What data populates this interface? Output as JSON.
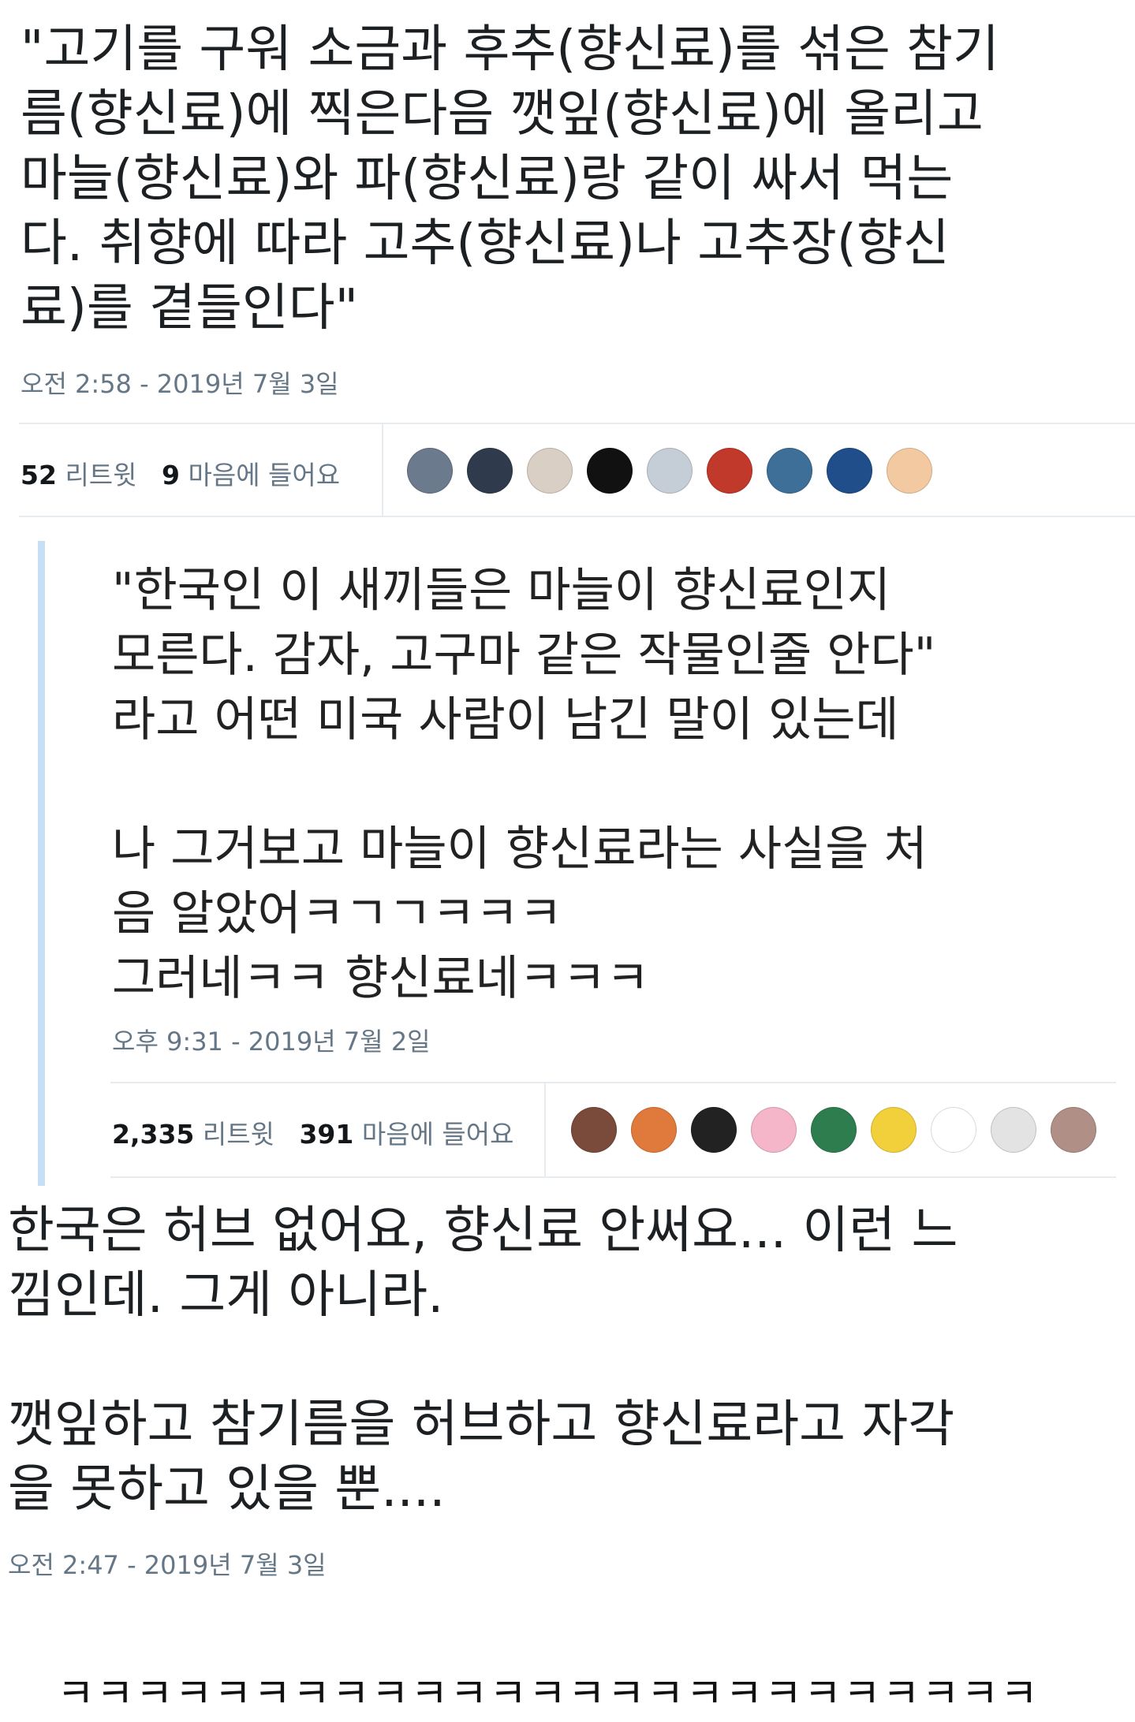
{
  "tweet1": {
    "text": "\"고기를 구워 소금과 후추(향신료)를 섞은 참기\n름(향신료)에 찍은다음 깻잎(향신료)에 올리고\n마늘(향신료)와 파(향신료)랑 같이 싸서 먹는\n다. 취향에 따라 고추(향신료)나 고추장(향신\n료)를 곁들인다\"",
    "timestamp": "오전 2:58 - 2019년 7월 3일",
    "retweet_count": "52",
    "retweet_label": "리트윗",
    "like_count": "9",
    "like_label": "마음에 들어요",
    "avatars": [
      {
        "icon": "astronaut-avatar",
        "color": "#6b7a8c"
      },
      {
        "icon": "person-avatar",
        "color": "#2f3b4c"
      },
      {
        "icon": "cartoon-face-avatar",
        "color": "#d9cfc4"
      },
      {
        "icon": "badge-avatar",
        "color": "#111111"
      },
      {
        "icon": "default-user-avatar",
        "color": "#c5ced6"
      },
      {
        "icon": "red-art-avatar",
        "color": "#c0392b"
      },
      {
        "icon": "whale-avatar",
        "color": "#3d6f98"
      },
      {
        "icon": "blue-character-avatar",
        "color": "#1f4e8a"
      },
      {
        "icon": "anime-girl-avatar",
        "color": "#f3c9a2"
      }
    ]
  },
  "quoted": {
    "text": "\"한국인 이 새끼들은 마늘이 향신료인지\n모른다. 감자, 고구마 같은 작물인줄 안다\"\n라고 어떤 미국 사람이 남긴 말이 있는데\n\n나 그거보고 마늘이 향신료라는 사실을 처\n음 알았어ㅋㄱㄱㅋㅋㅋ\n그러네ㅋㅋ 향신료네ㅋㅋㅋ",
    "timestamp": "오후 9:31 - 2019년 7월 2일",
    "retweet_count": "2,335",
    "retweet_label": "리트윗",
    "like_count": "391",
    "like_label": "마음에 들어요",
    "avatars": [
      {
        "icon": "doll-avatar",
        "color": "#7a4a3a"
      },
      {
        "icon": "orange-hair-avatar",
        "color": "#e07a3c"
      },
      {
        "icon": "dark-portrait-avatar",
        "color": "#222222"
      },
      {
        "icon": "pink-anime-avatar",
        "color": "#f4b6c8"
      },
      {
        "icon": "earth-avatar",
        "color": "#2e7d4f"
      },
      {
        "icon": "sponge-avatar",
        "color": "#f2d03b"
      },
      {
        "icon": "doodle-face-avatar",
        "color": "#ffffff"
      },
      {
        "icon": "sketch-cat-avatar",
        "color": "#e3e3e3"
      },
      {
        "icon": "portrait-avatar",
        "color": "#b08f86"
      }
    ]
  },
  "tweet2": {
    "text": "한국은 허브 없어요, 향신료 안써요... 이런 느\n낌인데. 그게 아니라.\n\n깻잎하고 참기름을 허브하고 향신료라고 자각\n을 못하고 있을 뿐....",
    "timestamp": "오전 2:47 - 2019년 7월 3일"
  },
  "caption": "ㅋㅋㅋㅋㅋㅋㅋㅋㅋㅋㅋㅋㅋㅋㅋㅋㅋㅋㅋㅋㅋㅋㅋㅋㅋ"
}
